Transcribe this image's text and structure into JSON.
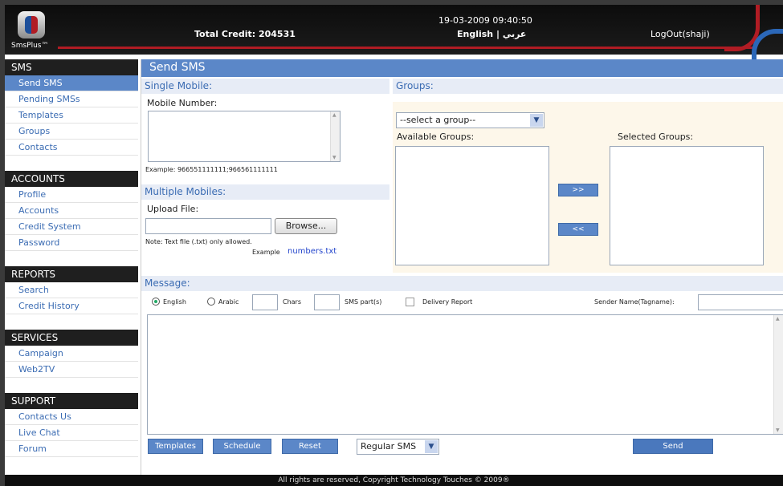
{
  "header": {
    "logo_text": "SmsPlus™",
    "total_credit": "Total Credit: 204531",
    "datetime": "19-03-2009 09:40:50",
    "language": "English | عربي",
    "logout": "LogOut(shaji)"
  },
  "sidebar": {
    "sections": [
      {
        "title": "SMS",
        "items": [
          "Send SMS",
          "Pending SMSs",
          "Templates",
          "Groups",
          "Contacts"
        ],
        "active": "Send SMS"
      },
      {
        "title": "ACCOUNTS",
        "items": [
          "Profile",
          "Accounts",
          "Credit System",
          "Password"
        ]
      },
      {
        "title": "REPORTS",
        "items": [
          "Search",
          "Credit History"
        ]
      },
      {
        "title": "SERVICES",
        "items": [
          "Campaign",
          "Web2TV"
        ]
      },
      {
        "title": "SUPPORT",
        "items": [
          "Contacts Us",
          "Live Chat",
          "Forum"
        ]
      }
    ]
  },
  "main": {
    "title": "Send SMS",
    "single_mobile": {
      "heading": "Single Mobile:",
      "label": "Mobile Number:",
      "example": "Example: 966551111111;966561111111"
    },
    "multiple_mobiles": {
      "heading": "Multiple Mobiles:",
      "upload_label": "Upload File:",
      "browse": "Browse...",
      "note": "Note: Text file (.txt) only allowed.",
      "example_prefix": "Example",
      "example_link": "numbers.txt"
    },
    "groups": {
      "heading": "Groups:",
      "select_value": "--select a group--",
      "available_label": "Available Groups:",
      "selected_label": "Selected Groups:",
      "add_button": ">>",
      "remove_button": "<<"
    },
    "message": {
      "heading": "Message:",
      "english": "English",
      "arabic": "Arabic",
      "chars": "Chars",
      "sms_parts": "SMS part(s)",
      "delivery_report": "Delivery Report",
      "sender_name": "Sender Name(Tagname):"
    },
    "actions": {
      "templates": "Templates",
      "schedule": "Schedule",
      "reset": "Reset",
      "sms_type": "Regular SMS",
      "send": "Send"
    }
  },
  "footer": "All rights are reserved, Copyright Technology Touches © 2009®",
  "colors": {
    "accent": "#5b87c8",
    "header": "#111111",
    "brand_red": "#b11c24",
    "panel": "#fdf7ea"
  }
}
